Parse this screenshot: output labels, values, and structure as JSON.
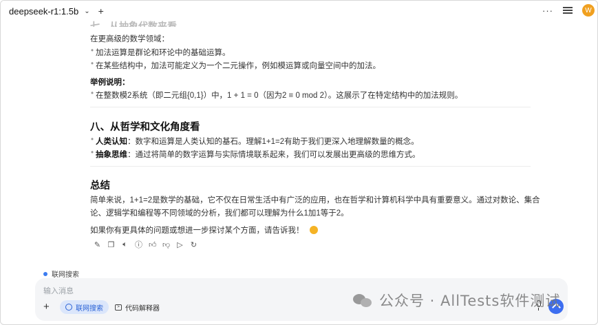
{
  "header": {
    "model": "deepseek-r1:1.5b",
    "more_glyph": "···",
    "avatar_letter": "W"
  },
  "content": {
    "cut_heading": "七、从抽象代数来看",
    "p1": "在更高级的数学领域：",
    "li1": "加法运算是群论和环论中的基础运算。",
    "li2": "在某些结构中，加法可能定义为一个二元操作，例如模运算或向量空间中的加法。",
    "example_label": "举例说明：",
    "li3": "在整数模2系统（即二元组{0,1}）中，1 + 1 = 0（因为2 ≡ 0 mod 2）。这展示了在特定结构中的加法规则。",
    "h8": "八、从哲学和文化角度看",
    "li4_b": "人类认知",
    "li4": "：数字和运算是人类认知的基石。理解1+1=2有助于我们更深入地理解数量的概念。",
    "li5_b": "抽象思维",
    "li5": "：通过将简单的数字运算与实际情境联系起来，我们可以发展出更高级的思维方式。",
    "summary_h": "总结",
    "summary_1": "简单来说，1+1=2是数学的基础，它不仅在日常生活中有广泛的应用，也在哲学和计算机科学中具有重要意义。通过对数论、集合",
    "summary_2": "论、逻辑学和编程等不同领域的分析，我们都可以理解为什么1加1等于2。",
    "closing": "如果你有更具体的问题或想进一步探讨某个方面，请告诉我！"
  },
  "actions": [
    "edit-icon",
    "copy-icon",
    "speaker-icon",
    "info-icon",
    "thumbs-up-icon",
    "thumbs-down-icon",
    "play-icon",
    "regenerate-icon"
  ],
  "composer": {
    "web_tag": "联网搜索",
    "placeholder": "输入消息",
    "web_chip": "联网搜索",
    "code_chip": "代码解释器"
  },
  "watermark": "公众号 · AllTests软件测试",
  "colors": {
    "accent": "#3d6ef0",
    "chip_bg": "#dbe6fb",
    "avatar": "#f0a020"
  }
}
